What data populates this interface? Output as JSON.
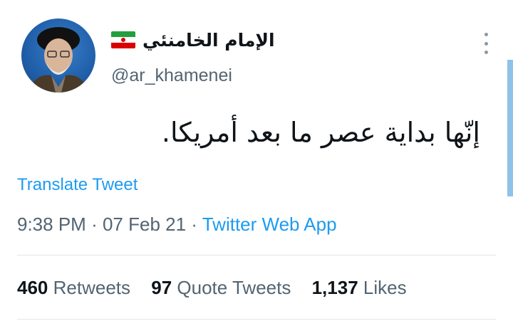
{
  "author": {
    "display_name": "الإمام الخامنئي",
    "handle": "@ar_khamenei",
    "flag_icon": "iran-flag-icon",
    "flag_colors": [
      "#239f40",
      "#ffffff",
      "#da0000"
    ]
  },
  "tweet": {
    "text": "إنّها بداية عصر ما بعد أمريكا.",
    "translate_label": "Translate Tweet",
    "time": "9:38 PM",
    "date": "07 Feb 21",
    "separator": "·",
    "source": "Twitter Web App"
  },
  "stats": {
    "retweets_count": "460",
    "retweets_label": "Retweets",
    "quotes_count": "97",
    "quotes_label": "Quote Tweets",
    "likes_count": "1,137",
    "likes_label": "Likes"
  },
  "colors": {
    "link": "#1d9bf0",
    "secondary_text": "#536471",
    "primary_text": "#0f1419"
  }
}
